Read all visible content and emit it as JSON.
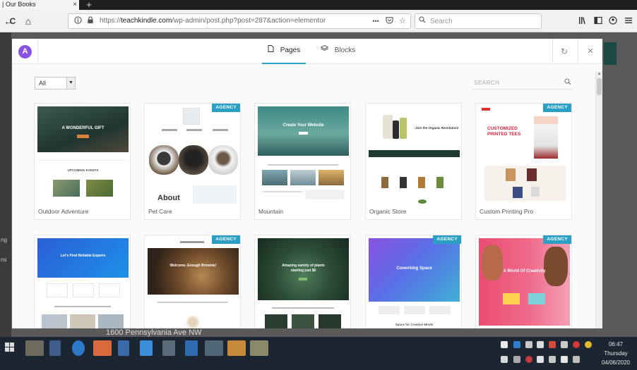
{
  "browser": {
    "tab_title": "| Our Books",
    "tab_close": "×",
    "new_tab": "+",
    "back_icon": "←",
    "reload_icon": "C",
    "home_icon": "⌂",
    "url_scheme": "https://",
    "url_host": "teachkindle.com",
    "url_path": "/wp-admin/post.php?post=287&action=elementor",
    "more_icon": "•••",
    "search_placeholder": "Search"
  },
  "wp_admin": {
    "side_fragments": [
      "ng",
      "ns"
    ],
    "footer_text": "1600 Pennsylvania Ave NW"
  },
  "modal": {
    "logo_letter": "A",
    "tabs": [
      {
        "label": "Pages",
        "icon": "page-icon",
        "active": true
      },
      {
        "label": "Blocks",
        "icon": "layers-icon",
        "active": false
      }
    ],
    "refresh_icon": "↻",
    "close_icon": "✕",
    "filter_value": "All",
    "search_placeholder": "SEARCH",
    "templates": [
      {
        "name": "Outdoor Adventure",
        "badge": "",
        "hero_text": "A WONDERFUL GIFT",
        "sub_text": "UPCOMING EVENTS"
      },
      {
        "name": "Pet Care",
        "badge": "AGENCY",
        "hero_text": "About",
        "sub_text": ""
      },
      {
        "name": "Mountain",
        "badge": "",
        "hero_text": "Create Your Website",
        "sub_text": ""
      },
      {
        "name": "Organic Store",
        "badge": "",
        "hero_text": "Join the Organic Revolution!",
        "sub_text": ""
      },
      {
        "name": "Custom Printing Pro",
        "badge": "AGENCY",
        "hero_text": "CUSTOMIZED PRINTED TEES",
        "sub_text": ""
      },
      {
        "name": "",
        "badge": "",
        "hero_text": "Let's Find Reliable Experts",
        "sub_text": ""
      },
      {
        "name": "",
        "badge": "AGENCY",
        "hero_text": "Welcome, Enough Brownie!",
        "sub_text": ""
      },
      {
        "name": "",
        "badge": "",
        "hero_text": "Amazing variety of plants starting just $6",
        "sub_text": ""
      },
      {
        "name": "",
        "badge": "AGENCY",
        "hero_text": "Coworking Space",
        "sub_text": "Space for Creative Minds"
      },
      {
        "name": "",
        "badge": "AGENCY",
        "hero_text": "A World Of Creativity",
        "sub_text": ""
      }
    ]
  },
  "taskbar": {
    "start_icon": "windows-start-icon",
    "time": "06:47",
    "day": "Thursday",
    "date": "04/06/2020"
  }
}
